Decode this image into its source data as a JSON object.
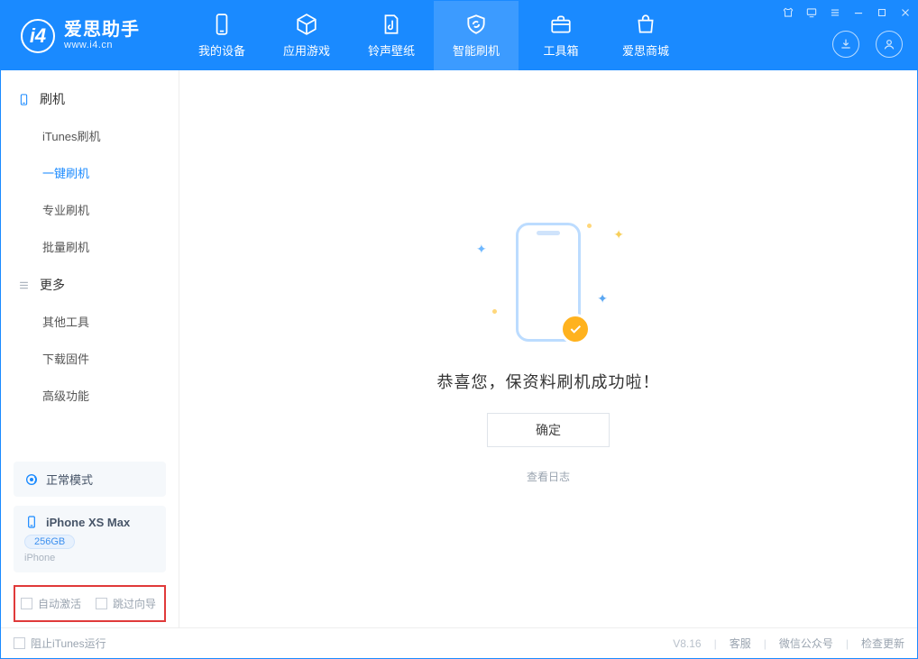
{
  "brand": {
    "title": "爱思助手",
    "subtitle": "www.i4.cn"
  },
  "tabs": [
    {
      "label": "我的设备"
    },
    {
      "label": "应用游戏"
    },
    {
      "label": "铃声壁纸"
    },
    {
      "label": "智能刷机"
    },
    {
      "label": "工具箱"
    },
    {
      "label": "爱思商城"
    }
  ],
  "sidebar": {
    "flash": {
      "title": "刷机",
      "items": [
        "iTunes刷机",
        "一键刷机",
        "专业刷机",
        "批量刷机"
      ]
    },
    "more": {
      "title": "更多",
      "items": [
        "其他工具",
        "下载固件",
        "高级功能"
      ]
    }
  },
  "mode_card": {
    "label": "正常模式"
  },
  "device_card": {
    "name": "iPhone XS Max",
    "storage": "256GB",
    "type": "iPhone"
  },
  "auto_activate_label": "自动激活",
  "skip_guide_label": "跳过向导",
  "main": {
    "success": "恭喜您，保资料刷机成功啦！",
    "ok": "确定",
    "viewlog": "查看日志"
  },
  "footer": {
    "block_itunes": "阻止iTunes运行",
    "version": "V8.16",
    "links": [
      "客服",
      "微信公众号",
      "检查更新"
    ]
  }
}
